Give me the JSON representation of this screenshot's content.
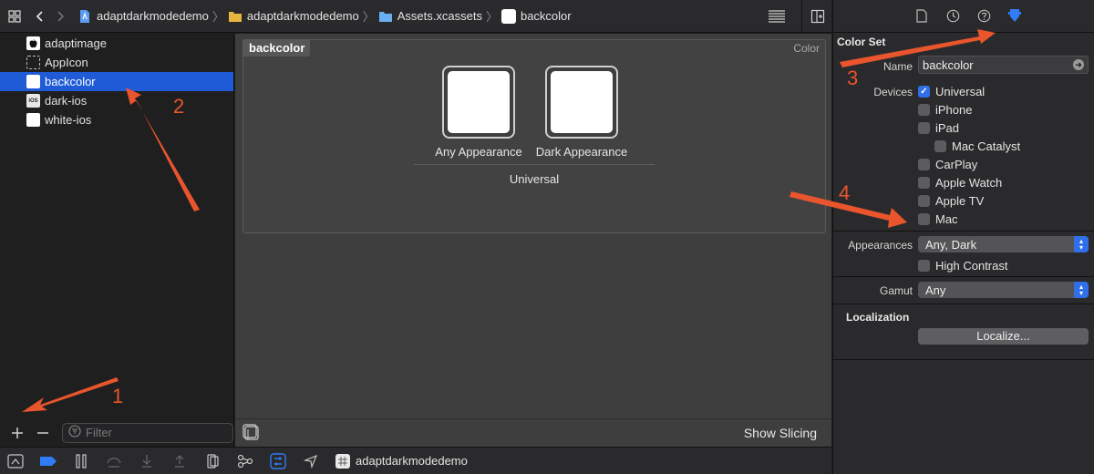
{
  "breadcrumbs": [
    {
      "label": "adaptdarkmodedemo",
      "icon": "project-icon",
      "color": "#5b9cf5"
    },
    {
      "label": "adaptdarkmodedemo",
      "icon": "folder-icon",
      "color": "#e8b640"
    },
    {
      "label": "Assets.xcassets",
      "icon": "asset-catalog-icon",
      "color": "#6ab0f0"
    },
    {
      "label": "backcolor",
      "icon": "color-set-icon",
      "color": "#ffffff"
    }
  ],
  "navigator": {
    "items": [
      {
        "label": "adaptimage",
        "icon": "apple-image-icon",
        "selected": false
      },
      {
        "label": "AppIcon",
        "icon": "appicon-placeholder-icon",
        "selected": false
      },
      {
        "label": "backcolor",
        "icon": "color-swatch-icon",
        "selected": true
      },
      {
        "label": "dark-ios",
        "icon": "ios-image-icon",
        "selected": false
      },
      {
        "label": "white-ios",
        "icon": "image-icon",
        "selected": false
      }
    ],
    "filter_placeholder": "Filter"
  },
  "editor": {
    "set_name": "backcolor",
    "set_type": "Color",
    "wells": [
      {
        "label": "Any Appearance",
        "color": "#ffffff"
      },
      {
        "label": "Dark Appearance",
        "color": "#ffffff"
      }
    ],
    "group_label": "Universal",
    "show_slicing": "Show Slicing"
  },
  "inspector": {
    "section_title": "Color Set",
    "name_label": "Name",
    "name_value": "backcolor",
    "devices_label": "Devices",
    "devices": [
      {
        "label": "Universal",
        "checked": true
      },
      {
        "label": "iPhone",
        "checked": false
      },
      {
        "label": "iPad",
        "checked": false
      },
      {
        "label": "Mac Catalyst",
        "checked": false
      },
      {
        "label": "CarPlay",
        "checked": false
      },
      {
        "label": "Apple Watch",
        "checked": false
      },
      {
        "label": "Apple TV",
        "checked": false
      },
      {
        "label": "Mac",
        "checked": false
      }
    ],
    "appearances_label": "Appearances",
    "appearances_value": "Any, Dark",
    "high_contrast_label": "High Contrast",
    "gamut_label": "Gamut",
    "gamut_value": "Any",
    "localization_title": "Localization",
    "localize_button": "Localize..."
  },
  "debug": {
    "scheme_name": "adaptdarkmodedemo"
  },
  "annotations": [
    "1",
    "2",
    "3",
    "4"
  ],
  "colors": {
    "accent": "#2f6fea",
    "selection": "#1f5bd6",
    "annotation": "#e9552c"
  }
}
